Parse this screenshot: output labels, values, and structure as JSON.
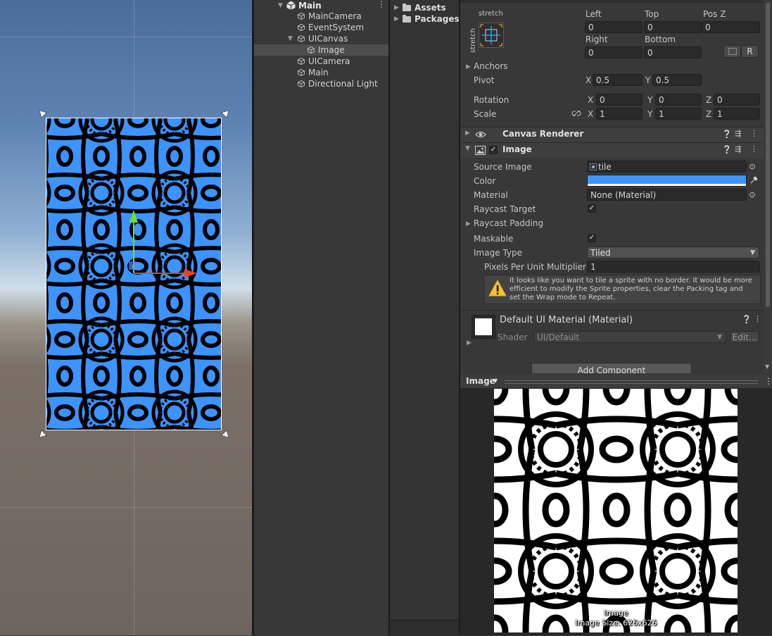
{
  "colors": {
    "image_tint": "#3d93ff",
    "pattern_stroke": "#000000",
    "gizmo_y": "#6fdb3c",
    "gizmo_x": "#e8402b",
    "panel_bg": "#383838"
  },
  "hierarchy": {
    "scene_name": "Main",
    "items": [
      {
        "label": "MainCamera",
        "icon": "gameobject-cube-icon"
      },
      {
        "label": "EventSystem",
        "icon": "gameobject-cube-icon"
      },
      {
        "label": "UICanvas",
        "icon": "gameobject-cube-icon"
      },
      {
        "label": "Image",
        "icon": "gameobject-cube-icon"
      },
      {
        "label": "UICamera",
        "icon": "gameobject-cube-icon"
      },
      {
        "label": "Main",
        "icon": "gameobject-cube-icon"
      },
      {
        "label": "Directional Light",
        "icon": "gameobject-cube-icon"
      }
    ],
    "selected": "Image"
  },
  "project": {
    "items": [
      "Assets",
      "Packages"
    ]
  },
  "rect_transform": {
    "anchor_preset_top": "stretch",
    "anchor_preset_side": "stretch",
    "left_label": "Left",
    "left": "0",
    "top_label": "Top",
    "top": "0",
    "posz_label": "Pos Z",
    "posz": "0",
    "right_label": "Right",
    "right": "0",
    "bottom_label": "Bottom",
    "bottom": "0",
    "r_button": "R",
    "anchors_label": "Anchors",
    "pivot_label": "Pivot",
    "pivot_x_axis": "X",
    "pivot_x": "0.5",
    "pivot_y_axis": "Y",
    "pivot_y": "0.5",
    "rotation_label": "Rotation",
    "rot_x": "0",
    "rot_y": "0",
    "rot_z": "0",
    "scale_label": "Scale",
    "scale_x": "1",
    "scale_y": "1",
    "scale_z": "1",
    "axis_x": "X",
    "axis_y": "Y",
    "axis_z": "Z"
  },
  "canvas_renderer": {
    "title": "Canvas Renderer"
  },
  "image_component": {
    "title": "Image",
    "enabled": true,
    "source_image_label": "Source Image",
    "source_image": "tile",
    "color_label": "Color",
    "color_value": "#3d93ff",
    "material_label": "Material",
    "material": "None (Material)",
    "raycast_target_label": "Raycast Target",
    "raycast_target": true,
    "raycast_padding_label": "Raycast Padding",
    "maskable_label": "Maskable",
    "maskable": true,
    "image_type_label": "Image Type",
    "image_type": "Tiled",
    "ppu_label": "Pixels Per Unit Multiplier",
    "ppu": "1",
    "warning": "It looks like you want to tile a sprite with no border. It would be more efficient to modify the Sprite properties, clear the Packing tag and set the Wrap mode to Repeat."
  },
  "material_section": {
    "title": "Default UI Material (Material)",
    "shader_label": "Shader",
    "shader": "UI/Default",
    "edit_button": "Edit..."
  },
  "add_component": "Add Component",
  "preview": {
    "dropdown": "Image",
    "name": "Image",
    "size": "Image Size: 626x626"
  }
}
